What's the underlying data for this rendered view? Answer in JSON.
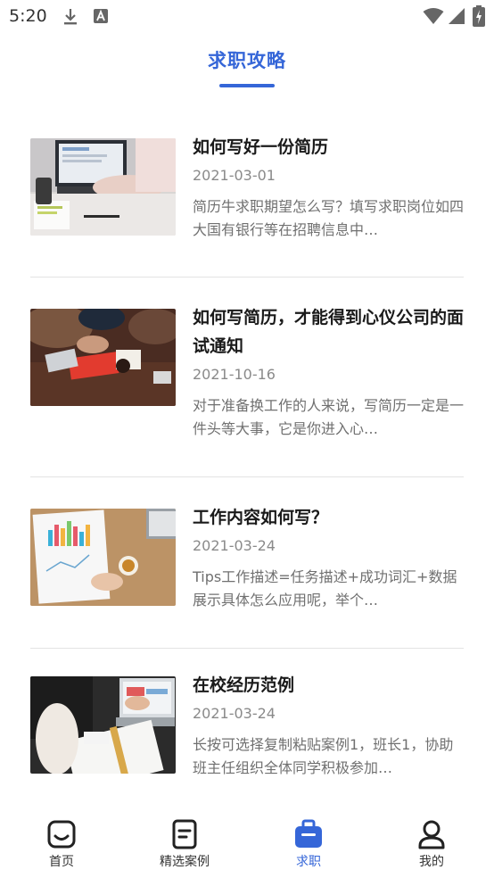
{
  "status_bar": {
    "time": "5:20"
  },
  "header": {
    "title": "求职攻略"
  },
  "articles": [
    {
      "title": "如何写好一份简历",
      "date": "2021-03-01",
      "summary": "简历牛求职期望怎么写？填写求职岗位如四大国有银行等在招聘信息中…"
    },
    {
      "title": "如何写简历，才能得到心仪公司的面试通知",
      "date": "2021-10-16",
      "summary": "对于准备换工作的人来说，写简历一定是一件头等大事，它是你进入心…"
    },
    {
      "title": "工作内容如何写？",
      "date": "2021-03-24",
      "summary": "Tips工作描述=任务描述+成功词汇+数据展示具体怎么应用呢，举个…"
    },
    {
      "title": "在校经历范例",
      "date": "2021-03-24",
      "summary": "长按可选择复制粘贴案例1，班长1，协助班主任组织全体同学积极参加…"
    }
  ],
  "bottom_nav": {
    "items": [
      {
        "label": "首页",
        "icon": "home-icon"
      },
      {
        "label": "精选案例",
        "icon": "document-icon"
      },
      {
        "label": "求职",
        "icon": "briefcase-icon",
        "active": true
      },
      {
        "label": "我的",
        "icon": "person-icon"
      }
    ]
  },
  "colors": {
    "accent": "#3566d8",
    "divider": "#e3e3e3",
    "text_secondary": "#8a8a8a"
  }
}
